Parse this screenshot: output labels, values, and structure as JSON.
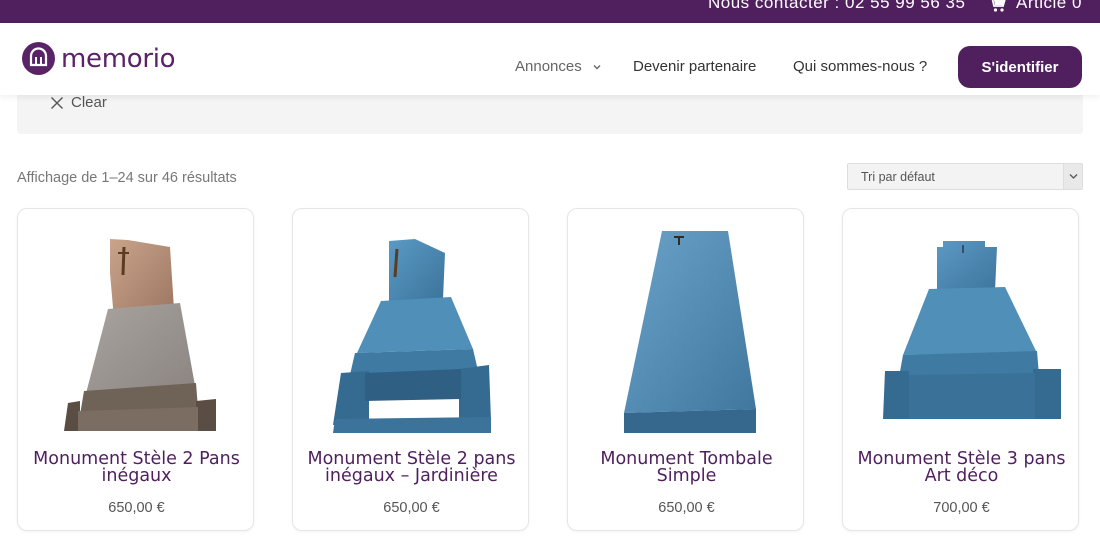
{
  "topbar": {
    "contact": "Nous contacter : 02 55 99 56 35",
    "cart_icon": "cart-icon",
    "cart_label": "Article 0"
  },
  "header": {
    "logo_text": "memorio",
    "nav": {
      "annonces": "Annonces",
      "partenaire": "Devenir partenaire",
      "qui": "Qui sommes-nous ?"
    },
    "login": "S'identifier"
  },
  "filters": {
    "clear_label": "Clear"
  },
  "results": {
    "count_text": "Affichage de 1–24 sur 46 résultats",
    "sort_selected": "Tri par défaut"
  },
  "products": [
    {
      "title": "Monument Stèle 2 Pans inégaux",
      "price": "650,00 €",
      "image": "monument-stele-2-pans-image"
    },
    {
      "title": "Monument Stèle 2 pans inégaux – Jardinière",
      "price": "650,00 €",
      "image": "monument-jardiniere-image"
    },
    {
      "title": "Monument Tombale Simple",
      "price": "650,00 €",
      "image": "monument-tombale-simple-image"
    },
    {
      "title": "Monument Stèle 3 pans Art déco",
      "price": "700,00 €",
      "image": "monument-art-deco-image"
    }
  ],
  "colors": {
    "brand": "#4f1f5e",
    "granite_pink": "#b4907a",
    "granite_blue": "#4f8fb8"
  }
}
